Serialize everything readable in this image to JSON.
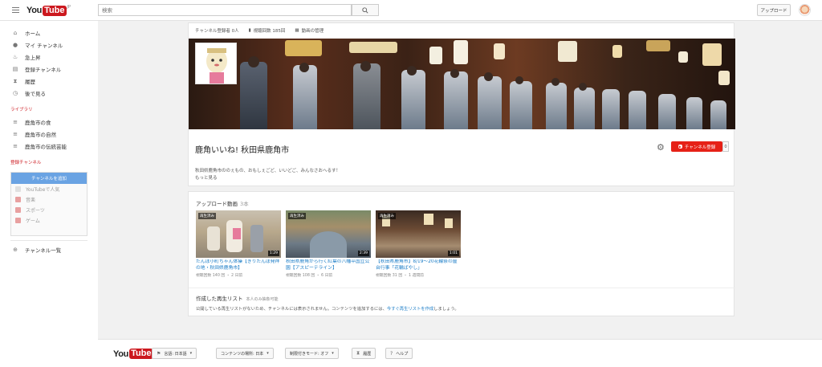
{
  "header": {
    "logo_you": "You",
    "logo_tube": "Tube",
    "logo_region": "JP",
    "search_placeholder": "検索",
    "upload_label": "アップロード"
  },
  "sidebar": {
    "items": [
      {
        "label": "ホーム",
        "icon": "home-icon"
      },
      {
        "label": "マイ チャンネル",
        "icon": "person-icon"
      },
      {
        "label": "急上昇",
        "icon": "flame-icon"
      },
      {
        "label": "登録チャンネル",
        "icon": "subscriptions-icon"
      },
      {
        "label": "履歴",
        "icon": "hourglass-icon"
      },
      {
        "label": "後で見る",
        "icon": "clock-icon"
      }
    ],
    "library_title": "ライブラリ",
    "library": [
      {
        "label": "鹿角市の食"
      },
      {
        "label": "鹿角市の自然"
      },
      {
        "label": "鹿角市の伝統芸能"
      }
    ],
    "subscriptions_title": "登録チャンネル",
    "browse_button": "チャンネルを追加",
    "recommended": [
      {
        "label": "YouTubeで人気",
        "color": "#e0e0e0"
      },
      {
        "label": "音楽",
        "color": "#e8a0a0"
      },
      {
        "label": "スポーツ",
        "color": "#e8a0a0"
      },
      {
        "label": "ゲーム",
        "color": "#e8a0a0"
      }
    ],
    "channel_list": "チャンネル一覧"
  },
  "channel": {
    "subscribers": "チャンネル登録者 0人",
    "views": "視聴回数 185回",
    "manage_videos": "動画の管理",
    "title": "鹿角いいね! 秋田県鹿角市",
    "subscribe_label": "チャンネル登録",
    "subscribe_count": "0",
    "description": "秋田県鹿角市ののぇもの、おもしぇごど、いいどご、みんなさおへるす！",
    "more": "もっと見る"
  },
  "uploads": {
    "title": "アップロード動画",
    "count": "3本",
    "videos": [
      {
        "title": "たんぽ小町ちゃん体操【きりたんぽ発祥の地・秋田県鹿角市】",
        "meta": "視聴回数 140 回 ・ 2 日前",
        "duration": "1:29",
        "played": "再生済み"
      },
      {
        "title": "秋田県鹿角から行く紅葉の八幡平国立公園【アスピーテライン】",
        "meta": "視聴回数 108 回 ・ 6 日前",
        "duration": "2:39",
        "played": "再生済み"
      },
      {
        "title": "【秋田県鹿角市】8/19〜20花輪祭の屋台行事「花輪ばやし」",
        "meta": "視聴回数 31 回 ・ 1 週間前",
        "duration": "1:01",
        "played": "再生済み"
      }
    ]
  },
  "playlists": {
    "title": "作成した再生リスト",
    "note": "本人のみ抽象可能",
    "text": "公開している再生リストがないため、チャンネルには表示されません。コンテンツを追加するには、",
    "link": "今すぐ再生リストを作成",
    "text_end": "しましょう。"
  },
  "footer": {
    "language": "言語: 日本語",
    "location": "コンテンツの場所: 日本",
    "restricted": "制限付きモード: オフ",
    "history": "履歴",
    "help": "ヘルプ"
  }
}
